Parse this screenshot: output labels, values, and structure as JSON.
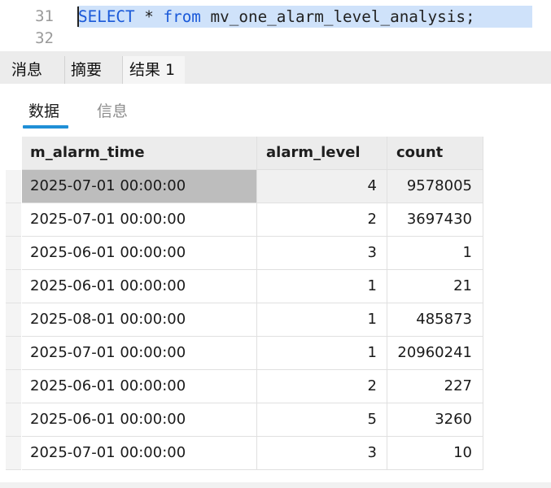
{
  "editor": {
    "line_numbers": [
      "31",
      "32"
    ],
    "sql": {
      "select": "SELECT",
      "star": " * ",
      "from": "from",
      "table": " mv_one_alarm_level_analysis;"
    }
  },
  "result_tabs": [
    {
      "label": "消息",
      "active": false
    },
    {
      "label": "摘要",
      "active": false
    },
    {
      "label": "结果 1",
      "active": true
    }
  ],
  "sub_tabs": [
    {
      "label": "数据",
      "active": true
    },
    {
      "label": "信息",
      "active": false
    }
  ],
  "table": {
    "columns": [
      "m_alarm_time",
      "alarm_level",
      "count"
    ],
    "selected_row": 0,
    "rows": [
      [
        "2025-07-01 00:00:00",
        "4",
        "9578005"
      ],
      [
        "2025-07-01 00:00:00",
        "2",
        "3697430"
      ],
      [
        "2025-06-01 00:00:00",
        "3",
        "1"
      ],
      [
        "2025-06-01 00:00:00",
        "1",
        "21"
      ],
      [
        "2025-08-01 00:00:00",
        "1",
        "485873"
      ],
      [
        "2025-07-01 00:00:00",
        "1",
        "20960241"
      ],
      [
        "2025-06-01 00:00:00",
        "2",
        "227"
      ],
      [
        "2025-06-01 00:00:00",
        "5",
        "3260"
      ],
      [
        "2025-07-01 00:00:00",
        "3",
        "10"
      ]
    ]
  },
  "colors": {
    "accent_underline": "#1f8fd6",
    "keyword": "#1a59d9",
    "selection": "#cfe2fa"
  }
}
